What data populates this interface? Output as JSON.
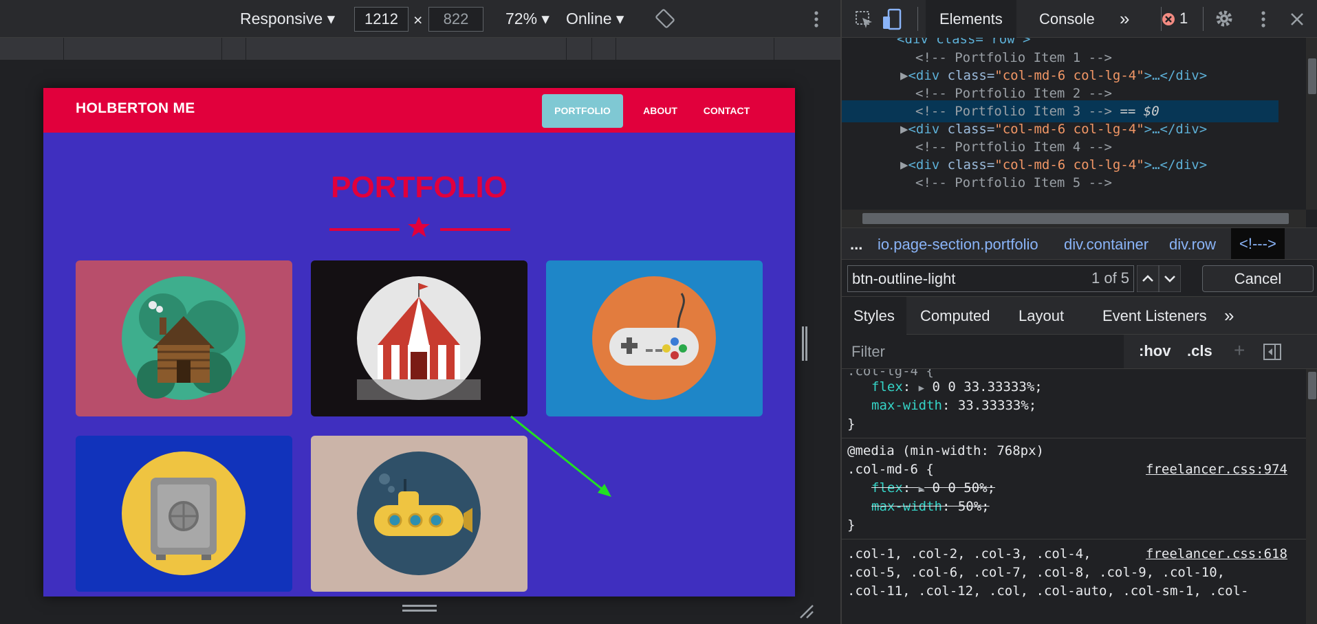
{
  "device_toolbar": {
    "device": "Responsive",
    "width_value": "1212",
    "height_placeholder": "822",
    "times": "×",
    "zoom": "72%",
    "network": "Online"
  },
  "website": {
    "brand": "HOLBERTON ME",
    "nav": [
      "PORTFOLIO",
      "ABOUT",
      "CONTACT"
    ],
    "title": "PORTFOLIO",
    "colors": {
      "navbar": "#e1003c",
      "body": "#3f2fbf",
      "active_nav": "#7fc8d3"
    },
    "cards": [
      {
        "icon": "log-cabin",
        "bg": "#b84e6b"
      },
      {
        "icon": "circus-tent",
        "bg": "#141013"
      },
      {
        "icon": "game-controller",
        "bg": "#1e86c8"
      },
      {
        "icon": "safe",
        "bg": "#1133bb"
      },
      {
        "icon": "submarine",
        "bg": "#cbb4a8"
      }
    ]
  },
  "devtools": {
    "tabs": {
      "elements": "Elements",
      "console": "Console",
      "more": "»"
    },
    "error_count": "1",
    "dom": {
      "top_partial": "<div class=\"row\">",
      "comment1": "<!-- Portfolio Item 1 -->",
      "comment2": "<!-- Portfolio Item 2 -->",
      "comment3": "<!-- Portfolio Item 3 -->",
      "selected_marker": "== $0",
      "comment4": "<!-- Portfolio Item 4 -->",
      "comment5_partial": "<!-- Portfolio Item 5 -->",
      "div_open": "<div ",
      "div_attr": "class=",
      "div_val": "\"col-md-6 col-lg-4\"",
      "div_close": ">…</div>"
    },
    "breadcrumb": [
      "...",
      "io.page-section.portfolio",
      "div.container",
      "div.row",
      "<!--->"
    ],
    "search": {
      "query": "btn-outline-light",
      "count": "1 of 5",
      "cancel": "Cancel"
    },
    "styles_tabs": [
      "Styles",
      "Computed",
      "Layout",
      "Event Listeners",
      "»"
    ],
    "filter": {
      "placeholder": "Filter",
      "hov": ":hov",
      "cls": ".cls",
      "plus": "+"
    },
    "styles": {
      "partial_selector": ".col-lg-4 {",
      "flex_label": "flex",
      "flex_value": "0 0 33.33333%;",
      "maxw_label": "max-width",
      "maxw_value": "33.33333%;",
      "close_brace": "}",
      "media": "@media (min-width: 768px)",
      "md6_selector": ".col-md-6 {",
      "md6_link": "freelancer.css:974",
      "md6_flex_value": "0 0 50%;",
      "md6_maxw_value": "50%;",
      "cols_line1": ".col-1, .col-2, .col-3, .col-4,",
      "cols_link": "freelancer.css:618",
      "cols_line2": ".col-5, .col-6, .col-7, .col-8, .col-9, .col-10,",
      "cols_line3": ".col-11, .col-12, .col, .col-auto, .col-sm-1, .col-"
    }
  }
}
